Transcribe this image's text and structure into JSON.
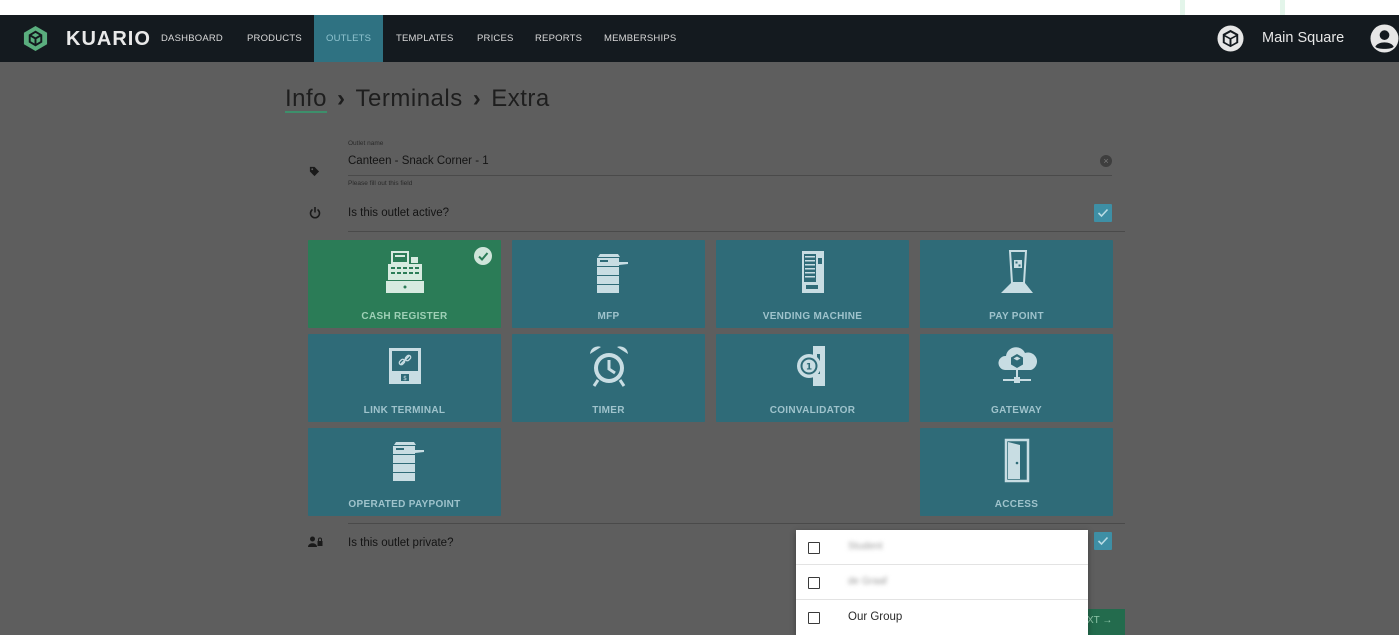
{
  "app": {
    "brand": "KUARIO",
    "venue": "Main Square"
  },
  "nav": {
    "items": [
      {
        "label": "DASHBOARD",
        "active": false
      },
      {
        "label": "PRODUCTS",
        "active": false
      },
      {
        "label": "OUTLETS",
        "active": true
      },
      {
        "label": "TEMPLATES",
        "active": false
      },
      {
        "label": "PRICES",
        "active": false
      },
      {
        "label": "REPORTS",
        "active": false
      },
      {
        "label": "MEMBERSHIPS",
        "active": false
      }
    ]
  },
  "breadcrumb": {
    "items": [
      "Info",
      "Terminals",
      "Extra"
    ],
    "separator": "›"
  },
  "form": {
    "outlet_name_label": "Outlet name",
    "outlet_name_value": "Canteen - Snack Corner - 1",
    "outlet_name_hint": "Please fill out this field",
    "active_question": "Is this outlet active?",
    "active_checked": true,
    "private_question": "Is this outlet private?",
    "private_checked": true
  },
  "terminals": [
    {
      "label": "CASH REGISTER",
      "icon": "cash-register-icon",
      "selected": true
    },
    {
      "label": "MFP",
      "icon": "mfp-printer-icon",
      "selected": false
    },
    {
      "label": "VENDING MACHINE",
      "icon": "vending-machine-icon",
      "selected": false
    },
    {
      "label": "PAY POINT",
      "icon": "pay-point-icon",
      "selected": false
    },
    {
      "label": "LINK TERMINAL",
      "icon": "link-terminal-icon",
      "selected": false
    },
    {
      "label": "TIMER",
      "icon": "alarm-clock-icon",
      "selected": false
    },
    {
      "label": "COINVALIDATOR",
      "icon": "coin-validator-icon",
      "selected": false
    },
    {
      "label": "GATEWAY",
      "icon": "cloud-gateway-icon",
      "selected": false
    },
    {
      "label": "OPERATED PAYPOINT",
      "icon": "operated-paypoint-icon",
      "selected": false
    },
    {
      "label": "ACCESS",
      "icon": "door-icon",
      "selected": false
    }
  ],
  "group_dropdown": {
    "options": [
      {
        "label": "Student",
        "checked": false,
        "blurred": true
      },
      {
        "label": "de Graaf",
        "checked": false,
        "blurred": true
      },
      {
        "label": "Our Group",
        "checked": false,
        "blurred": false
      }
    ]
  },
  "next_button": {
    "label": "XT →"
  },
  "colors": {
    "navbar": "#141a1f",
    "nav_active": "#2f7282",
    "tile": "#2f6b78",
    "tile_selected": "#2b7c57",
    "checkbox": "#3e8fa5",
    "overlay_bg": "#5e5e5e"
  }
}
